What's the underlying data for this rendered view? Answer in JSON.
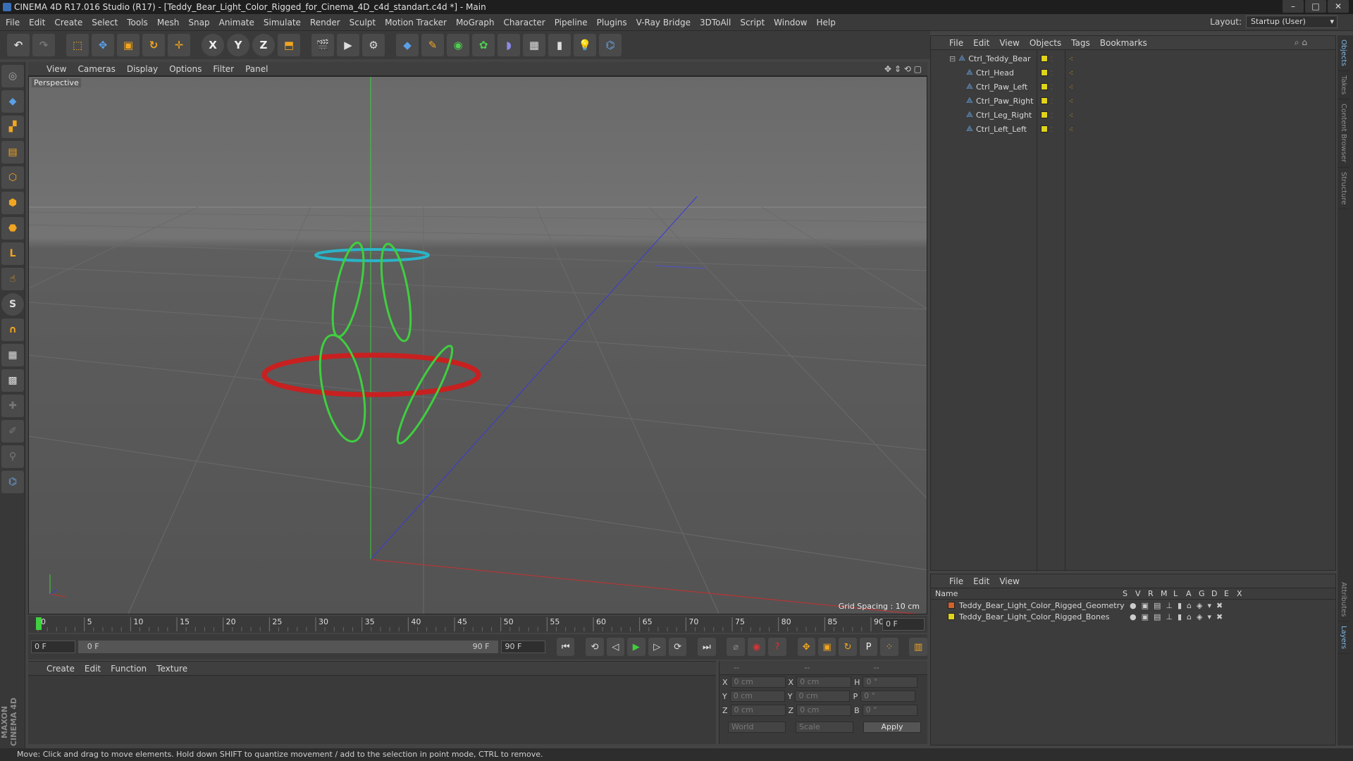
{
  "window": {
    "title": "CINEMA 4D R17.016 Studio (R17) - [Teddy_Bear_Light_Color_Rigged_for_Cinema_4D_c4d_standart.c4d *] - Main",
    "buttons": [
      "–",
      "□",
      "✕"
    ]
  },
  "menubar": {
    "items": [
      "File",
      "Edit",
      "Create",
      "Select",
      "Tools",
      "Mesh",
      "Snap",
      "Animate",
      "Simulate",
      "Render",
      "Sculpt",
      "Motion Tracker",
      "MoGraph",
      "Character",
      "Pipeline",
      "Plugins",
      "V-Ray Bridge",
      "3DToAll",
      "Script",
      "Window",
      "Help"
    ],
    "layout_label": "Layout:",
    "layout_value": "Startup (User)"
  },
  "toolbar": {
    "icons": [
      "undo-icon",
      "redo-icon",
      "live-select-icon",
      "move-icon",
      "scale-icon",
      "rotate-icon",
      "recent-tool-icon",
      "x-axis-icon",
      "y-axis-icon",
      "z-axis-icon",
      "coordinate-system-icon",
      "render-view-icon",
      "render-picture-viewer-icon",
      "render-settings-icon",
      "cube-icon",
      "pen-icon",
      "subdivision-icon",
      "array-icon",
      "deformer-icon",
      "floor-icon",
      "camera-icon",
      "light-icon",
      "python-icon"
    ],
    "axis_labels": [
      "X",
      "Y",
      "Z"
    ]
  },
  "viewport": {
    "menu": [
      "View",
      "Cameras",
      "Display",
      "Options",
      "Filter",
      "Panel"
    ],
    "label": "Perspective",
    "grid_spacing": "Grid Spacing : 10 cm",
    "colors": {
      "head_ring": "#2ab4c8",
      "paw_ring": "#3fcf3f",
      "body_ring": "#c82020"
    }
  },
  "timeline": {
    "ticks": [
      "0",
      "5",
      "10",
      "15",
      "20",
      "25",
      "30",
      "35",
      "40",
      "45",
      "50",
      "55",
      "60",
      "65",
      "70",
      "75",
      "80",
      "85",
      "90"
    ],
    "current_frame": "0 F"
  },
  "transport": {
    "start": "0 F",
    "range_start": "0 F",
    "range_end": "90 F",
    "end": "90 F"
  },
  "material": {
    "menu": [
      "Create",
      "Edit",
      "Function",
      "Texture"
    ]
  },
  "coords": {
    "headers": [
      "--",
      "--",
      "--"
    ],
    "rows": [
      {
        "a": "X",
        "av": "0 cm",
        "b": "X",
        "bv": "0 cm",
        "c": "H",
        "cv": "0 °"
      },
      {
        "a": "Y",
        "av": "0 cm",
        "b": "Y",
        "bv": "0 cm",
        "c": "P",
        "cv": "0 °"
      },
      {
        "a": "Z",
        "av": "0 cm",
        "b": "Z",
        "bv": "0 cm",
        "c": "B",
        "cv": "0 °"
      }
    ],
    "mode1": "World",
    "mode2": "Scale",
    "apply": "Apply"
  },
  "objects": {
    "menu": [
      "File",
      "Edit",
      "View",
      "Objects",
      "Tags",
      "Bookmarks"
    ],
    "items": [
      "Ctrl_Teddy_Bear",
      "Ctrl_Head",
      "Ctrl_Paw_Left",
      "Ctrl_Paw_Right",
      "Ctrl_Leg_Right",
      "Ctrl_Left_Left"
    ]
  },
  "layers": {
    "menu": [
      "File",
      "Edit",
      "View"
    ],
    "name_header": "Name",
    "col_headers": [
      "S",
      "V",
      "R",
      "M",
      "L",
      "A",
      "G",
      "D",
      "E",
      "X"
    ],
    "rows": [
      {
        "name": "Teddy_Bear_Light_Color_Rigged_Geometry",
        "color": "#d0622a"
      },
      {
        "name": "Teddy_Bear_Light_Color_Rigged_Bones",
        "color": "#e0d31a"
      }
    ]
  },
  "sidetabs": {
    "top": [
      "Objects",
      "Takes",
      "Content Browser",
      "Structure"
    ],
    "bottom": [
      "Attributes",
      "Layers"
    ]
  },
  "brand": "MAXON CINEMA 4D",
  "status": "Move: Click and drag to move elements. Hold down SHIFT to quantize movement / add to the selection in point mode, CTRL to remove."
}
